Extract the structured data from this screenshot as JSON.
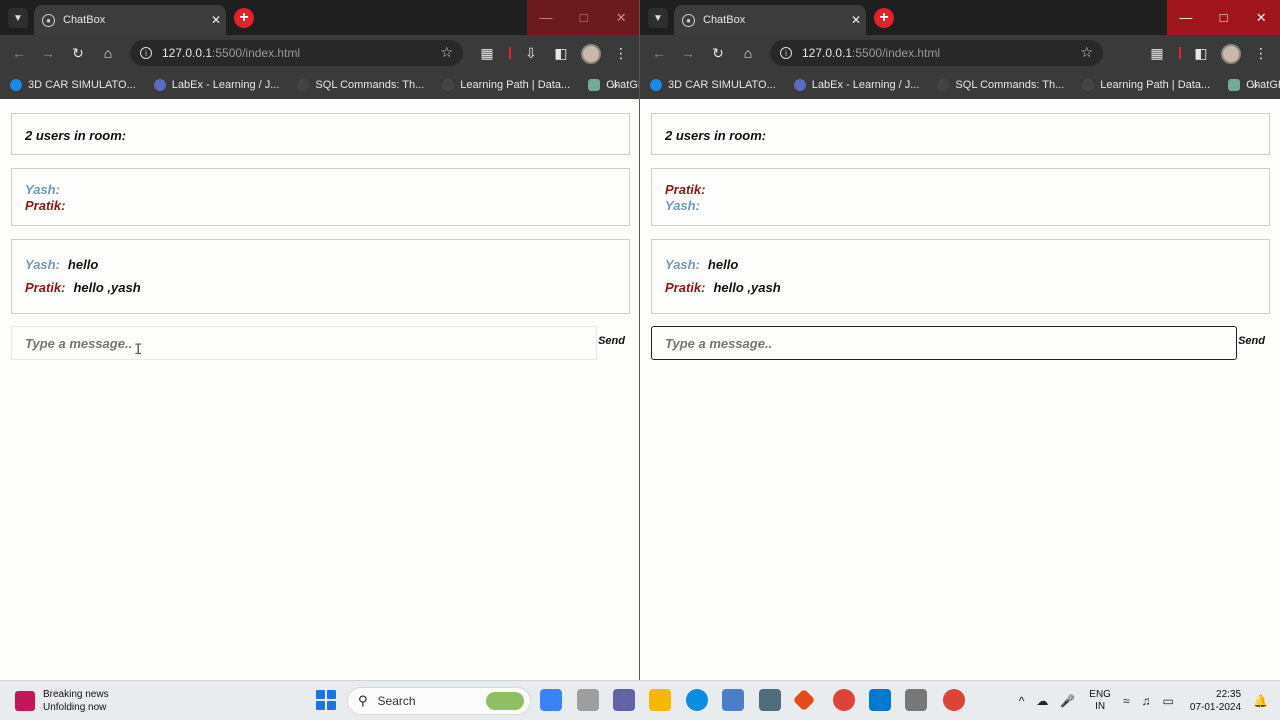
{
  "left_window": {
    "tab_title": "ChatBox",
    "url_host": "127.0.0.1",
    "url_path": ":5500/index.html",
    "bookmarks": [
      "3D CAR SIMULATO...",
      "LabEx - Learning / J...",
      "SQL Commands: Th...",
      "Learning Path | Data...",
      "ChatGPT"
    ],
    "users_count": "2 users in room:",
    "users": [
      {
        "name": "Yash:",
        "color": "#6f9ab5"
      },
      {
        "name": "Pratik:",
        "color": "#8b1a1a"
      }
    ],
    "messages": [
      {
        "name": "Yash:",
        "text": "hello",
        "color": "#6f9ab5"
      },
      {
        "name": "Pratik:",
        "text": "hello ,yash",
        "color": "#8b1a1a"
      }
    ],
    "input_placeholder": "Type a message..",
    "send_label": "Send"
  },
  "right_window": {
    "tab_title": "ChatBox",
    "url_host": "127.0.0.1",
    "url_path": ":5500/index.html",
    "bookmarks": [
      "3D CAR SIMULATO...",
      "LabEx - Learning / J...",
      "SQL Commands: Th...",
      "Learning Path | Data...",
      "ChatGPT"
    ],
    "users_count": "2 users in room:",
    "users": [
      {
        "name": "Pratik:",
        "color": "#8b1a1a"
      },
      {
        "name": "Yash:",
        "color": "#6f9ab5"
      }
    ],
    "messages": [
      {
        "name": "Yash:",
        "text": "hello",
        "color": "#6f9ab5"
      },
      {
        "name": "Pratik:",
        "text": "hello ,yash",
        "color": "#8b1a1a"
      }
    ],
    "input_placeholder": "Type a message..",
    "send_label": "Send"
  },
  "taskbar": {
    "news_title": "Breaking news",
    "news_subtitle": "Unfolding now",
    "search_label": "Search",
    "lang_top": "ENG",
    "lang_bottom": "IN",
    "time": "22:35",
    "date": "07-01-2024"
  },
  "colors": {
    "accent_red": "#e2222b",
    "user_yash": "#6f9ab5",
    "user_pratik": "#8b1a1a"
  }
}
